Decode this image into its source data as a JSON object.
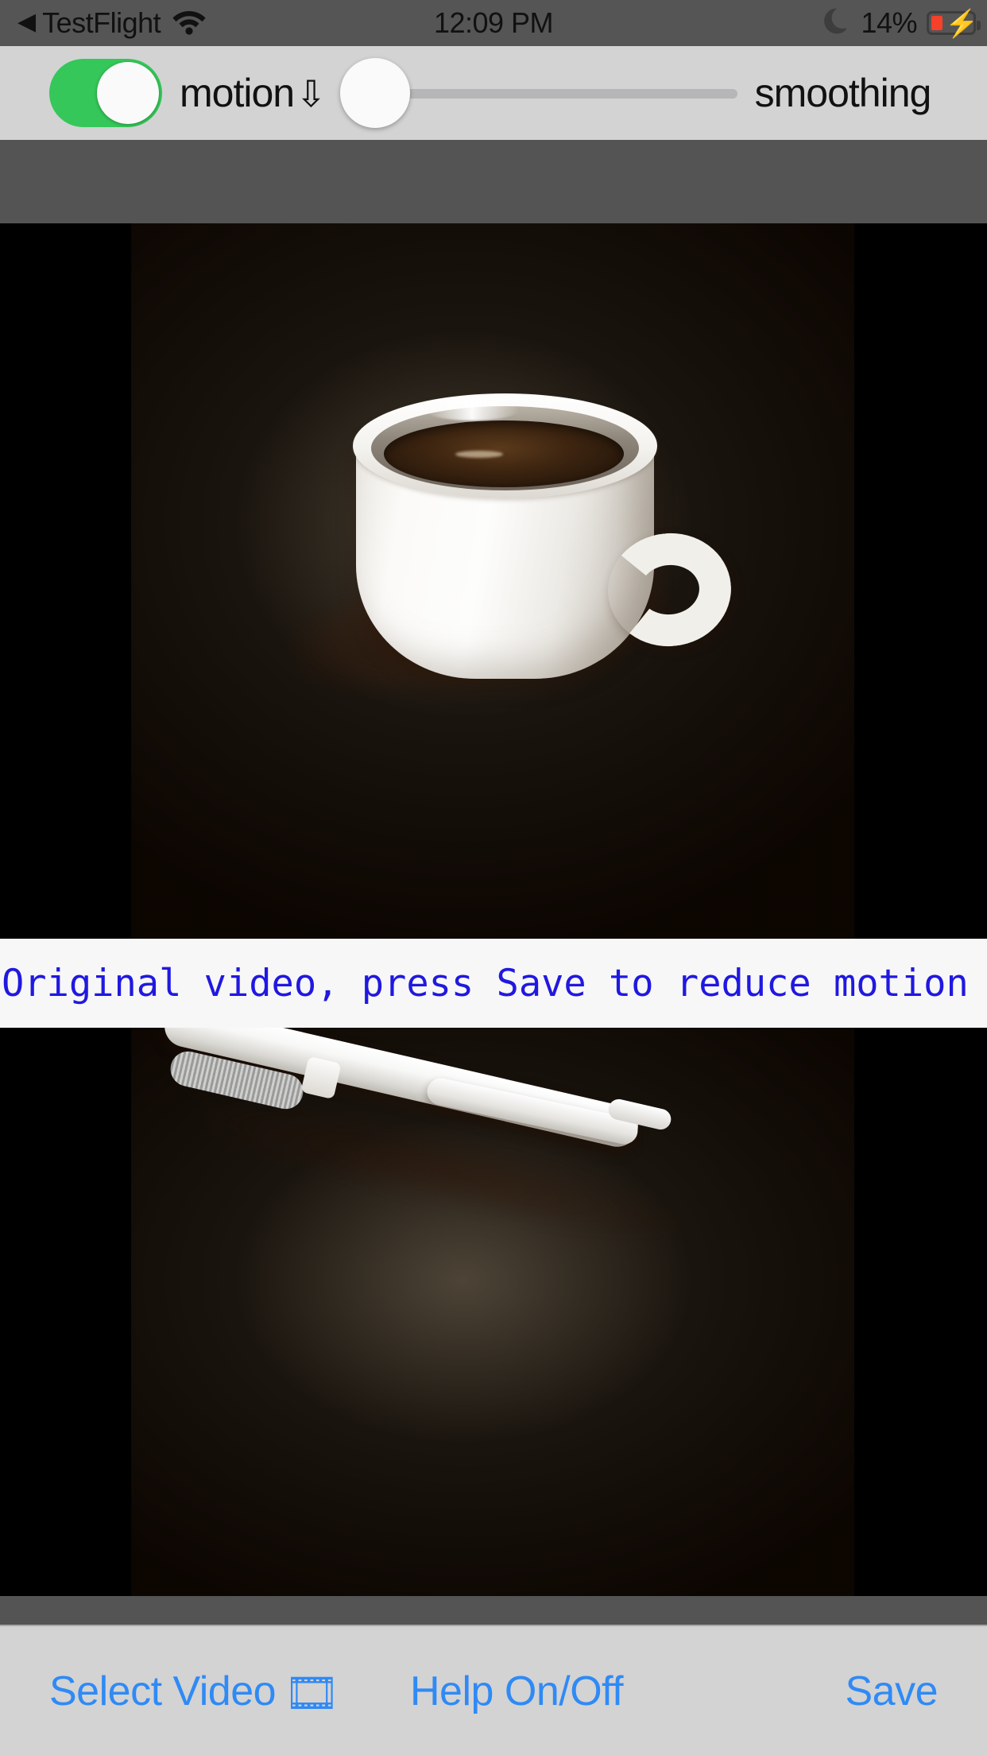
{
  "status_bar": {
    "back_icon": "back-triangle-icon",
    "carrier_app": "TestFlight",
    "wifi_icon": "wifi-icon",
    "time": "12:09 PM",
    "moon_icon": "do-not-disturb-moon-icon",
    "battery_percent": "14%",
    "battery_charging_icon": "lightning-bolt-icon",
    "battery_level": 14,
    "battery_fill_color": "#f5402a"
  },
  "controls": {
    "motion_toggle": {
      "label": "motion",
      "arrow_glyph": "⇩",
      "state": "on",
      "on_color": "#35c759"
    },
    "smoothing_slider": {
      "label": "smoothing",
      "value": 0,
      "min": 0,
      "max": 100,
      "track_color": "#b6b6b8"
    }
  },
  "preview": {
    "top_video": {
      "name": "original-video-preview",
      "subject": "white coffee mug on wooden table"
    },
    "bottom_video": {
      "name": "processed-video-preview",
      "subject": "white mechanical pencil on wooden table"
    }
  },
  "caption": {
    "text": "Original video, press Save to reduce motion",
    "color": "#2018e0",
    "background": "#f7f7f7"
  },
  "toolbar": {
    "select_video_label": "Select Video",
    "select_video_icon": "film-frames-icon",
    "select_video_glyph": "🎞",
    "help_label": "Help On/Off",
    "save_label": "Save",
    "tint_color": "#2f8af5",
    "background": "#d3d3d4"
  }
}
